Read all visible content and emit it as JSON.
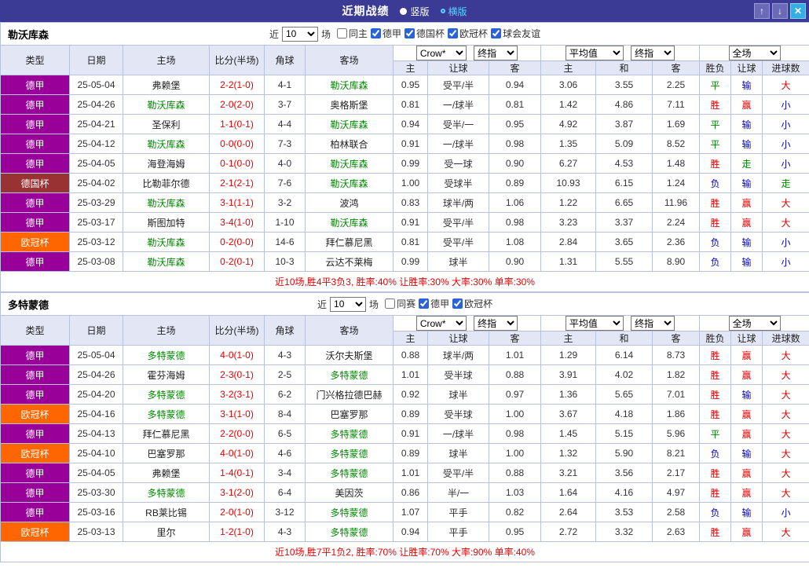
{
  "titlebar": {
    "title": "近期战绩",
    "radios": [
      {
        "label": "竖版",
        "active": false
      },
      {
        "label": "横版",
        "active": true
      }
    ],
    "buttons": {
      "up": "↑",
      "down": "↓",
      "close": "✕"
    }
  },
  "table_headers": {
    "left": [
      "类型",
      "日期",
      "主场",
      "比分(半场)",
      "角球",
      "客场"
    ],
    "sub": [
      "主",
      "让球",
      "客",
      "主",
      "和",
      "客",
      "胜负",
      "让球",
      "进球数"
    ]
  },
  "type_colors": {
    "德甲": "#990099",
    "德国杯": "#993333",
    "欧冠杯": "#ff6600"
  },
  "result_colors": {
    "胜": "#e60000",
    "平": "#008800",
    "负": "#0000cc",
    "赢": "#e60000",
    "输": "#0000cc",
    "走": "#008800",
    "大": "#e60000",
    "小": "#0000cc"
  },
  "sections": [
    {
      "team": "勒沃库森",
      "filter": {
        "prefix": "近",
        "count": "10",
        "suffix": "场",
        "checkboxes": [
          {
            "label": "同主",
            "checked": false
          },
          {
            "label": "德甲",
            "checked": true
          },
          {
            "label": "德国杯",
            "checked": true
          },
          {
            "label": "欧冠杯",
            "checked": true
          },
          {
            "label": "球会友谊",
            "checked": true
          }
        ]
      },
      "dropdowns": {
        "odds_source": "Crow*",
        "odds_time": "终指",
        "euro_source": "平均值",
        "euro_time": "终指",
        "scope": "全场"
      },
      "rows": [
        {
          "type": "德甲",
          "date": "25-05-04",
          "home": "弗赖堡",
          "score": "2-2(1-0)",
          "corner": "4-1",
          "away": "勒沃库森",
          "asian": [
            "0.95",
            "受平/半",
            "0.94"
          ],
          "euro": [
            "3.06",
            "3.55",
            "2.25"
          ],
          "results": [
            "平",
            "输",
            "大"
          ]
        },
        {
          "type": "德甲",
          "date": "25-04-26",
          "home": "勒沃库森",
          "score": "2-0(2-0)",
          "corner": "3-7",
          "away": "奥格斯堡",
          "asian": [
            "0.81",
            "一/球半",
            "0.81"
          ],
          "euro": [
            "1.42",
            "4.86",
            "7.11"
          ],
          "results": [
            "胜",
            "赢",
            "小"
          ]
        },
        {
          "type": "德甲",
          "date": "25-04-21",
          "home": "圣保利",
          "score": "1-1(0-1)",
          "corner": "4-4",
          "away": "勒沃库森",
          "asian": [
            "0.94",
            "受半/一",
            "0.95"
          ],
          "euro": [
            "4.92",
            "3.87",
            "1.69"
          ],
          "results": [
            "平",
            "输",
            "小"
          ]
        },
        {
          "type": "德甲",
          "date": "25-04-12",
          "home": "勒沃库森",
          "score": "0-0(0-0)",
          "corner": "7-3",
          "away": "柏林联合",
          "asian": [
            "0.91",
            "一/球半",
            "0.98"
          ],
          "euro": [
            "1.35",
            "5.09",
            "8.52"
          ],
          "results": [
            "平",
            "输",
            "小"
          ]
        },
        {
          "type": "德甲",
          "date": "25-04-05",
          "home": "海登海姆",
          "score": "0-1(0-0)",
          "corner": "4-0",
          "away": "勒沃库森",
          "asian": [
            "0.99",
            "受一球",
            "0.90"
          ],
          "euro": [
            "6.27",
            "4.53",
            "1.48"
          ],
          "results": [
            "胜",
            "走",
            "小"
          ]
        },
        {
          "type": "德国杯",
          "date": "25-04-02",
          "home": "比勒菲尔德",
          "score": "2-1(2-1)",
          "corner": "7-6",
          "away": "勒沃库森",
          "asian": [
            "1.00",
            "受球半",
            "0.89"
          ],
          "euro": [
            "10.93",
            "6.15",
            "1.24"
          ],
          "results": [
            "负",
            "输",
            "走"
          ]
        },
        {
          "type": "德甲",
          "date": "25-03-29",
          "home": "勒沃库森",
          "score": "3-1(1-1)",
          "corner": "3-2",
          "away": "波鸿",
          "asian": [
            "0.83",
            "球半/两",
            "1.06"
          ],
          "euro": [
            "1.22",
            "6.65",
            "11.96"
          ],
          "results": [
            "胜",
            "赢",
            "大"
          ]
        },
        {
          "type": "德甲",
          "date": "25-03-17",
          "home": "斯图加特",
          "score": "3-4(1-0)",
          "corner": "1-10",
          "away": "勒沃库森",
          "asian": [
            "0.91",
            "受平/半",
            "0.98"
          ],
          "euro": [
            "3.23",
            "3.37",
            "2.24"
          ],
          "results": [
            "胜",
            "赢",
            "大"
          ]
        },
        {
          "type": "欧冠杯",
          "date": "25-03-12",
          "home": "勒沃库森",
          "score": "0-2(0-0)",
          "corner": "14-6",
          "away": "拜仁慕尼黑",
          "asian": [
            "0.81",
            "受平/半",
            "1.08"
          ],
          "euro": [
            "2.84",
            "3.65",
            "2.36"
          ],
          "results": [
            "负",
            "输",
            "小"
          ]
        },
        {
          "type": "德甲",
          "date": "25-03-08",
          "home": "勒沃库森",
          "score": "0-2(0-1)",
          "corner": "10-3",
          "away": "云达不莱梅",
          "asian": [
            "0.99",
            "球半",
            "0.90"
          ],
          "euro": [
            "1.31",
            "5.55",
            "8.90"
          ],
          "results": [
            "负",
            "输",
            "小"
          ]
        }
      ],
      "summary": "近10场,胜4平3负3, 胜率:40% 让胜率:30% 大率:30% 单率:30%"
    },
    {
      "team": "多特蒙德",
      "filter": {
        "prefix": "近",
        "count": "10",
        "suffix": "场",
        "checkboxes": [
          {
            "label": "同赛",
            "checked": false
          },
          {
            "label": "德甲",
            "checked": true
          },
          {
            "label": "欧冠杯",
            "checked": true
          }
        ]
      },
      "dropdowns": {
        "odds_source": "Crow*",
        "odds_time": "终指",
        "euro_source": "平均值",
        "euro_time": "终指",
        "scope": "全场"
      },
      "rows": [
        {
          "type": "德甲",
          "date": "25-05-04",
          "home": "多特蒙德",
          "score": "4-0(1-0)",
          "corner": "4-3",
          "away": "沃尔夫斯堡",
          "asian": [
            "0.88",
            "球半/两",
            "1.01"
          ],
          "euro": [
            "1.29",
            "6.14",
            "8.73"
          ],
          "results": [
            "胜",
            "赢",
            "大"
          ]
        },
        {
          "type": "德甲",
          "date": "25-04-26",
          "home": "霍芬海姆",
          "score": "2-3(0-1)",
          "corner": "2-5",
          "away": "多特蒙德",
          "asian": [
            "1.01",
            "受半球",
            "0.88"
          ],
          "euro": [
            "3.91",
            "4.02",
            "1.82"
          ],
          "results": [
            "胜",
            "赢",
            "大"
          ]
        },
        {
          "type": "德甲",
          "date": "25-04-20",
          "home": "多特蒙德",
          "score": "3-2(3-1)",
          "corner": "6-2",
          "away": "门兴格拉德巴赫",
          "asian": [
            "0.92",
            "球半",
            "0.97"
          ],
          "euro": [
            "1.36",
            "5.65",
            "7.01"
          ],
          "results": [
            "胜",
            "输",
            "大"
          ]
        },
        {
          "type": "欧冠杯",
          "date": "25-04-16",
          "home": "多特蒙德",
          "score": "3-1(1-0)",
          "corner": "8-4",
          "away": "巴塞罗那",
          "asian": [
            "0.89",
            "受半球",
            "1.00"
          ],
          "euro": [
            "3.67",
            "4.18",
            "1.86"
          ],
          "results": [
            "胜",
            "赢",
            "大"
          ]
        },
        {
          "type": "德甲",
          "date": "25-04-13",
          "home": "拜仁慕尼黑",
          "score": "2-2(0-0)",
          "corner": "6-5",
          "away": "多特蒙德",
          "asian": [
            "0.91",
            "一/球半",
            "0.98"
          ],
          "euro": [
            "1.45",
            "5.15",
            "5.96"
          ],
          "results": [
            "平",
            "赢",
            "大"
          ]
        },
        {
          "type": "欧冠杯",
          "date": "25-04-10",
          "home": "巴塞罗那",
          "score": "4-0(1-0)",
          "corner": "4-6",
          "away": "多特蒙德",
          "asian": [
            "0.89",
            "球半",
            "1.00"
          ],
          "euro": [
            "1.32",
            "5.90",
            "8.21"
          ],
          "results": [
            "负",
            "输",
            "大"
          ]
        },
        {
          "type": "德甲",
          "date": "25-04-05",
          "home": "弗赖堡",
          "score": "1-4(0-1)",
          "corner": "3-4",
          "away": "多特蒙德",
          "asian": [
            "1.01",
            "受平/半",
            "0.88"
          ],
          "euro": [
            "3.21",
            "3.56",
            "2.17"
          ],
          "results": [
            "胜",
            "赢",
            "大"
          ]
        },
        {
          "type": "德甲",
          "date": "25-03-30",
          "home": "多特蒙德",
          "score": "3-1(2-0)",
          "corner": "6-4",
          "away": "美因茨",
          "asian": [
            "0.86",
            "半/一",
            "1.03"
          ],
          "euro": [
            "1.64",
            "4.16",
            "4.97"
          ],
          "results": [
            "胜",
            "赢",
            "大"
          ]
        },
        {
          "type": "德甲",
          "date": "25-03-16",
          "home": "RB莱比锡",
          "score": "2-0(1-0)",
          "corner": "3-12",
          "away": "多特蒙德",
          "asian": [
            "1.07",
            "平手",
            "0.82"
          ],
          "euro": [
            "2.64",
            "3.53",
            "2.58"
          ],
          "results": [
            "负",
            "输",
            "小"
          ]
        },
        {
          "type": "欧冠杯",
          "date": "25-03-13",
          "home": "里尔",
          "score": "1-2(1-0)",
          "corner": "4-3",
          "away": "多特蒙德",
          "asian": [
            "0.94",
            "平手",
            "0.95"
          ],
          "euro": [
            "2.72",
            "3.32",
            "2.63"
          ],
          "results": [
            "胜",
            "赢",
            "大"
          ]
        }
      ],
      "summary": "近10场,胜7平1负2, 胜率:70% 让胜率:70% 大率:90% 单率:40%"
    }
  ]
}
